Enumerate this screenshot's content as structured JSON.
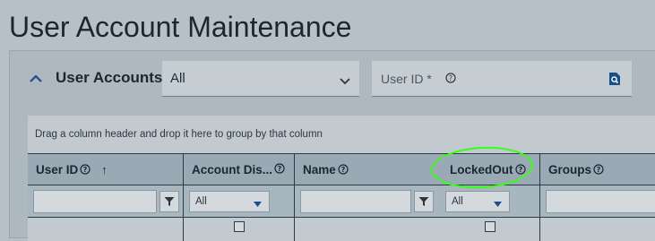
{
  "page": {
    "title": "User Account Maintenance"
  },
  "panel": {
    "title": "User Accounts",
    "filter_select": {
      "value": "All"
    },
    "userid_field": {
      "placeholder": "User ID *"
    }
  },
  "grid": {
    "group_hint": "Drag a column header and drop it here to group by that column",
    "columns": [
      {
        "label": "User ID",
        "sort": "ascending"
      },
      {
        "label": "Account Dis..."
      },
      {
        "label": "Name"
      },
      {
        "label": "LockedOut"
      },
      {
        "label": "Groups"
      }
    ],
    "filters": {
      "account_disabled": "All",
      "locked_out": "All"
    }
  },
  "icons": {
    "collapse": "chevron-up-icon",
    "dropdown": "chevron-down-icon",
    "help": "question-circle-icon",
    "lookup": "search-document-icon",
    "filter": "funnel-icon"
  },
  "colors": {
    "annotation": "#39ff14",
    "accent": "#1b4f8a"
  }
}
